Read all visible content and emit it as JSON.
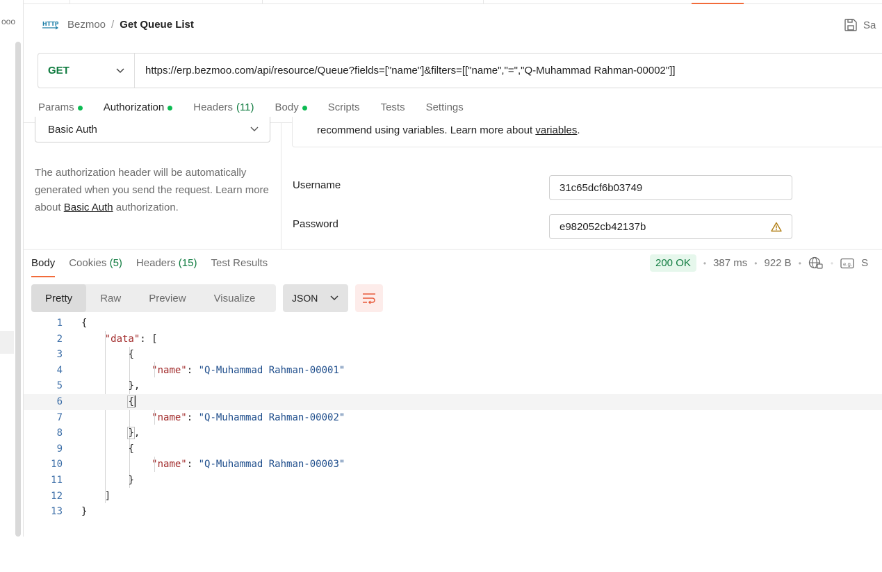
{
  "header": {
    "http_icon_text": "HTTP",
    "collection": "Bezmoo",
    "separator": "/",
    "request_name": "Get Queue List",
    "save_label": "Sa"
  },
  "left_sidebar": {
    "more_icon": "more-horizontal-icon",
    "more_text": "ooo"
  },
  "request": {
    "method": "GET",
    "url": "https://erp.bezmoo.com/api/resource/Queue?fields=[\"name\"]&filters=[[\"name\",\"=\",\"Q-Muhammad Rahman-00002\"]]"
  },
  "request_tabs": [
    {
      "label": "Params",
      "dot": true,
      "count": ""
    },
    {
      "label": "Authorization",
      "dot": true,
      "count": "",
      "active": true
    },
    {
      "label": "Headers",
      "dot": false,
      "count": "(11)"
    },
    {
      "label": "Body",
      "dot": true,
      "count": ""
    },
    {
      "label": "Scripts",
      "dot": false,
      "count": ""
    },
    {
      "label": "Tests",
      "dot": false,
      "count": ""
    },
    {
      "label": "Settings",
      "dot": false,
      "count": ""
    }
  ],
  "auth": {
    "type": "Basic Auth",
    "desc_1": "The authorization header will be automatically generated when you send the request. Learn more about ",
    "desc_link": "Basic Auth",
    "desc_2": " authorization.",
    "info_1": "recommend using variables. Learn more about ",
    "info_link": "variables",
    "info_2": ".",
    "username_label": "Username",
    "username_value": "31c65dcf6b03749",
    "password_label": "Password",
    "password_value": "e982052cb42137b"
  },
  "response_tabs": [
    {
      "label": "Body",
      "count": "",
      "active": true
    },
    {
      "label": "Cookies",
      "count": "(5)"
    },
    {
      "label": "Headers",
      "count": "(15)"
    },
    {
      "label": "Test Results",
      "count": ""
    }
  ],
  "response_meta": {
    "status": "200 OK",
    "time": "387 ms",
    "size": "922 B",
    "sep": "•",
    "example_label": "S"
  },
  "view_modes": [
    "Pretty",
    "Raw",
    "Preview",
    "Visualize"
  ],
  "active_view": "Pretty",
  "format": "JSON",
  "code": {
    "lines": [
      "1",
      "2",
      "3",
      "4",
      "5",
      "6",
      "7",
      "8",
      "9",
      "10",
      "11",
      "12",
      "13"
    ],
    "open_brace": "{",
    "close_brace": "}",
    "data_key": "\"data\"",
    "colon_bracket": ": [",
    "close_bracket": "]",
    "name_key": "\"name\"",
    "colon": ": ",
    "comma": ",",
    "values": [
      "\"Q-Muhammad Rahman-00001\"",
      "\"Q-Muhammad Rahman-00002\"",
      "\"Q-Muhammad Rahman-00003\""
    ]
  },
  "colors": {
    "accent": "#f26b3a",
    "method_green": "#0f7b3f",
    "status_dot": "#0cbb52",
    "json_key": "#a12a2a",
    "json_string": "#1f4e8c"
  }
}
